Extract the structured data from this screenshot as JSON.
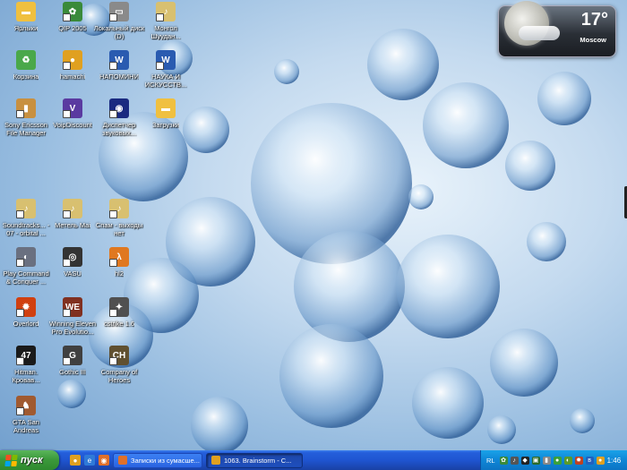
{
  "desktop": {
    "icons": [
      {
        "id": "yarlyki",
        "label": "Ярлыки",
        "glyph": "▬",
        "color": "#f0c040",
        "col": 0,
        "row": 0,
        "shortcut": false
      },
      {
        "id": "qip",
        "label": "QIP 2005",
        "glyph": "✿",
        "color": "#3a8a3a",
        "col": 1,
        "row": 0,
        "shortcut": true
      },
      {
        "id": "local-disk-d",
        "label": "Локальный диск (D)",
        "glyph": "▭",
        "color": "#8a8a8a",
        "col": 2,
        "row": 0,
        "shortcut": true
      },
      {
        "id": "mongol",
        "label": "Монгол Шуудан...",
        "glyph": "♪",
        "color": "#d8c070",
        "col": 3,
        "row": 0,
        "shortcut": true
      },
      {
        "id": "recycle",
        "label": "Корзина",
        "glyph": "♻",
        "color": "#4aa84a",
        "col": 0,
        "row": 1,
        "shortcut": false
      },
      {
        "id": "hamachi",
        "label": "hamachi",
        "glyph": "●",
        "color": "#e0a020",
        "col": 1,
        "row": 1,
        "shortcut": true
      },
      {
        "id": "napominanie",
        "label": "НАПОМИНИ",
        "glyph": "W",
        "color": "#2a5bb0",
        "col": 2,
        "row": 1,
        "shortcut": true
      },
      {
        "id": "nauka",
        "label": "НАУКА И ИСКУССТВ...",
        "glyph": "W",
        "color": "#2a5bb0",
        "col": 3,
        "row": 1,
        "shortcut": true
      },
      {
        "id": "sonyericsson",
        "label": "Sony Ericsson File Manager",
        "glyph": "▮",
        "color": "#c89040",
        "col": 0,
        "row": 2,
        "shortcut": true
      },
      {
        "id": "voipdiscount",
        "label": "VoipDiscount",
        "glyph": "V",
        "color": "#5a3aa0",
        "col": 1,
        "row": 2,
        "shortcut": true
      },
      {
        "id": "dispatcher",
        "label": "Диспетчер звуковых...",
        "glyph": "◉",
        "color": "#1a2a80",
        "col": 2,
        "row": 2,
        "shortcut": true
      },
      {
        "id": "zagruzki",
        "label": "Загрузки",
        "glyph": "▬",
        "color": "#f0c040",
        "col": 3,
        "row": 2,
        "shortcut": false
      },
      {
        "id": "soundtracks",
        "label": "Soundtracks... - 07 - orbital ...",
        "glyph": "♪",
        "color": "#d8c070",
        "col": 0,
        "row": 4,
        "shortcut": true
      },
      {
        "id": "metelno",
        "label": "Метель Mai",
        "glyph": "♪",
        "color": "#d8c070",
        "col": 1,
        "row": 4,
        "shortcut": true
      },
      {
        "id": "spiski",
        "label": "Спам - выходы нет",
        "glyph": "♪",
        "color": "#d8c070",
        "col": 2,
        "row": 4,
        "shortcut": true
      },
      {
        "id": "playcommand",
        "label": "Play Command & Conquer ...",
        "glyph": "◐",
        "color": "#6a7080",
        "col": 0,
        "row": 5,
        "shortcut": true
      },
      {
        "id": "vasu",
        "label": "VASU",
        "glyph": "◎",
        "color": "#333333",
        "col": 1,
        "row": 5,
        "shortcut": true
      },
      {
        "id": "hl2",
        "label": "hl2",
        "glyph": "λ",
        "color": "#e07820",
        "col": 2,
        "row": 5,
        "shortcut": true
      },
      {
        "id": "overlord",
        "label": "Overlord",
        "glyph": "✹",
        "color": "#d04010",
        "col": 0,
        "row": 6,
        "shortcut": true
      },
      {
        "id": "winning-eleven",
        "label": "Winning Eleven Pro Evolutio...",
        "glyph": "WE",
        "color": "#803020",
        "col": 1,
        "row": 6,
        "shortcut": true
      },
      {
        "id": "cstrike",
        "label": "cstrike 1.6",
        "glyph": "✦",
        "color": "#505050",
        "col": 2,
        "row": 6,
        "shortcut": true
      },
      {
        "id": "hitman",
        "label": "Hitman. Кровав...",
        "glyph": "47",
        "color": "#1a1a1a",
        "col": 0,
        "row": 7,
        "shortcut": true
      },
      {
        "id": "gothic",
        "label": "Gothic III",
        "glyph": "G",
        "color": "#404040",
        "col": 1,
        "row": 7,
        "shortcut": true
      },
      {
        "id": "company-heroes",
        "label": "Company of Heroes",
        "glyph": "CH",
        "color": "#605030",
        "col": 2,
        "row": 7,
        "shortcut": true
      },
      {
        "id": "gta",
        "label": "GTA San Andreas",
        "glyph": "♞",
        "color": "#a05a30",
        "col": 0,
        "row": 8,
        "shortcut": true
      }
    ]
  },
  "weather": {
    "temperature": "17°",
    "city": "Moscow"
  },
  "taskbar": {
    "start_label": "пуск",
    "tasks": [
      {
        "label": "Записки из сумасше...",
        "icon_color": "#e0702a",
        "active": false
      },
      {
        "label": "1063. Brainstorm - C...",
        "icon_color": "#e0a020",
        "active": true
      }
    ],
    "tray": {
      "language": "RL",
      "clock": "1:46"
    }
  },
  "colors": {
    "start_green": "#3c9a3c",
    "taskbar_blue": "#245edb",
    "tray_blue": "#0f88d8"
  }
}
